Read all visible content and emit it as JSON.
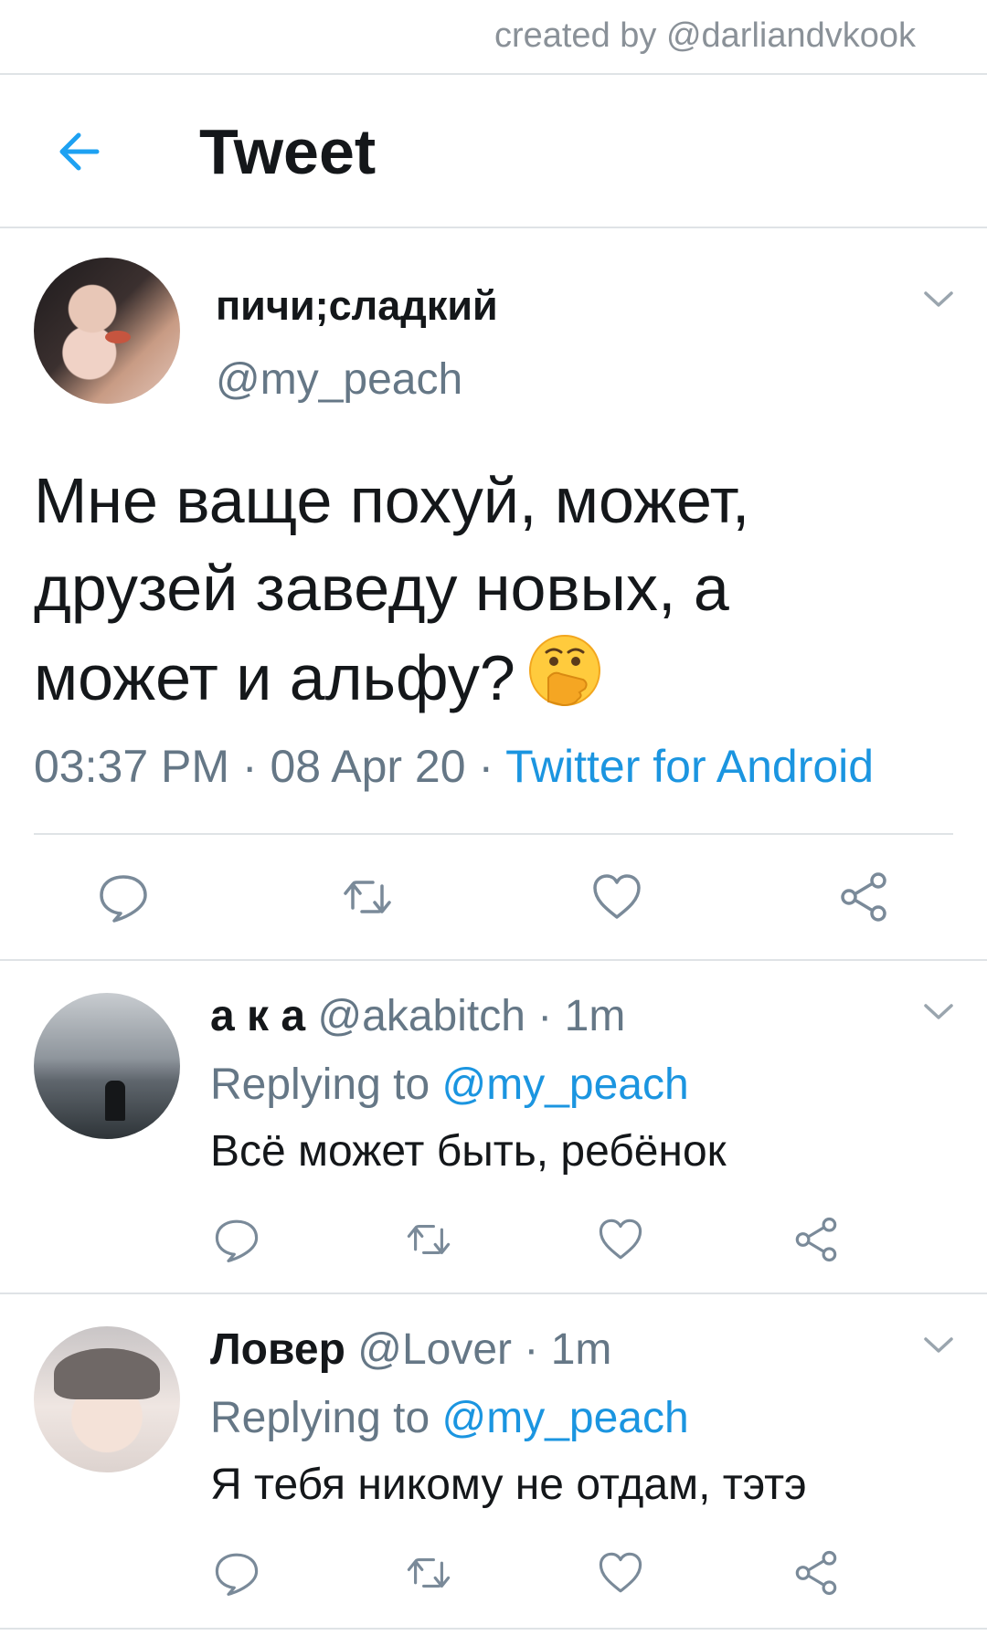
{
  "watermark": "created by @darliandvkook",
  "header": {
    "title": "Tweet"
  },
  "tweet": {
    "display_name": "пичи;сладкий",
    "handle": "@my_peach",
    "text": "Мне ваще похуй, может, друзей заведу новых, а может и альфу?",
    "emoji": "face-with-hand-over-mouth",
    "time": "03:37 PM",
    "date": "08 Apr 20",
    "separator": "·",
    "source": "Twitter for Android"
  },
  "replies": [
    {
      "display_name": "а к а",
      "handle": "@akabitch",
      "age": "1m",
      "replying_label": "Replying to",
      "replying_to": "@my_peach",
      "text": "Всё может быть, ребёнок"
    },
    {
      "display_name": "Ловер",
      "handle": "@Lover",
      "age": "1m",
      "replying_label": "Replying to",
      "replying_to": "@my_peach",
      "text": "Я тебя никому не отдам, тэтэ"
    }
  ],
  "icons": {
    "back": "arrow-left-icon",
    "more": "chevron-down-icon",
    "reply": "reply-bubble-icon",
    "retweet": "retweet-icon",
    "like": "heart-icon",
    "share": "share-icon"
  },
  "colors": {
    "accent": "#1b95e0",
    "text": "#14171a",
    "muted": "#657786",
    "divider": "#dfe3e6"
  }
}
